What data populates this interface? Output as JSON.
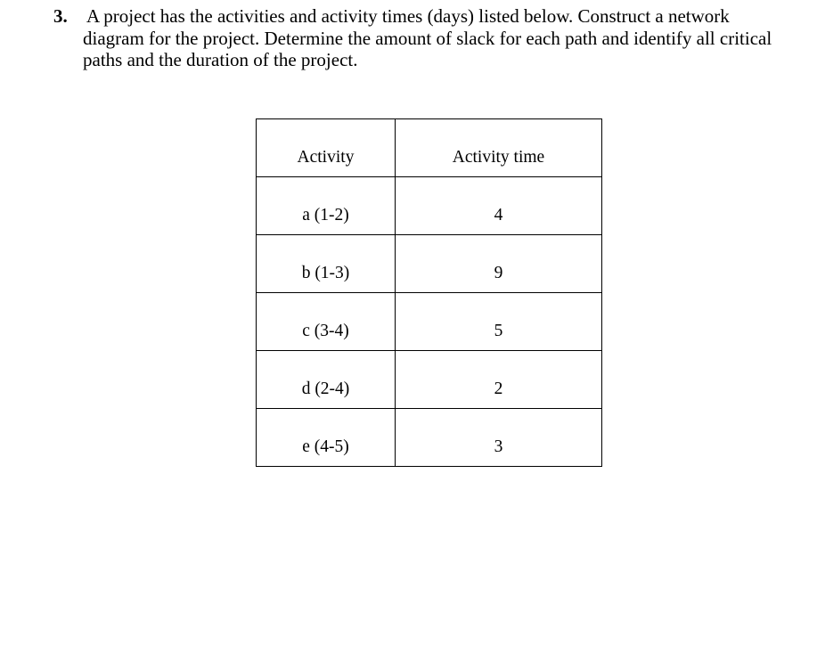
{
  "question": {
    "number": "3.",
    "lines": [
      "A project has the activities and activity times (days) listed below. Construct a network",
      "diagram for the project. Determine the amount of slack for each path and identify all critical",
      "paths and the duration of the project."
    ]
  },
  "table": {
    "headers": [
      "Activity",
      "Activity time"
    ],
    "rows": [
      {
        "activity": "a (1-2)",
        "time": "4"
      },
      {
        "activity": "b (1-3)",
        "time": "9"
      },
      {
        "activity": "c (3-4)",
        "time": "5"
      },
      {
        "activity": "d (2-4)",
        "time": "2"
      },
      {
        "activity": "e (4-5)",
        "time": "3"
      }
    ]
  }
}
